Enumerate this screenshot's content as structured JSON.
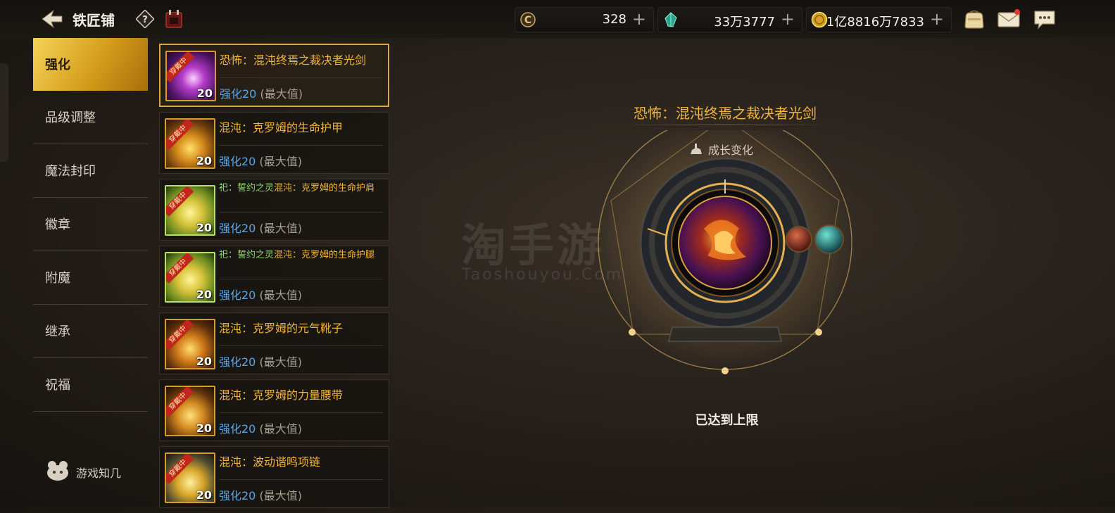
{
  "header": {
    "title": "铁匠铺",
    "currencies": [
      {
        "icon": "c-coin-icon",
        "value": "328"
      },
      {
        "icon": "crystal-icon",
        "value": "33万3777"
      },
      {
        "icon": "gold-coin-icon",
        "value": "1亿8816万7833"
      }
    ],
    "plus_symbol": "+"
  },
  "sidebar": {
    "items": [
      {
        "label": "强化",
        "active": true
      },
      {
        "label": "品级调整"
      },
      {
        "label": "魔法封印"
      },
      {
        "label": "徽章"
      },
      {
        "label": "附魔"
      },
      {
        "label": "继承"
      },
      {
        "label": "祝福"
      }
    ],
    "footer": "游戏知几"
  },
  "equipment": [
    {
      "name": "恐怖：混沌终焉之裁决者光剑",
      "level": "强化20",
      "max": "(最大值)",
      "thumb_level": "20",
      "badge": "穿戴中",
      "selected": true
    },
    {
      "name": "混沌：克罗姆的生命护甲",
      "level": "强化20",
      "max": "(最大值)",
      "thumb_level": "20",
      "badge": "穿戴中"
    },
    {
      "prefix": "祀：誓约之灵",
      "name": "混沌：克罗姆的生命护肩",
      "level": "强化20",
      "max": "(最大值)",
      "thumb_level": "20",
      "badge": "穿戴中"
    },
    {
      "prefix": "祀：誓约之灵",
      "name": "混沌：克罗姆的生命护腿",
      "level": "强化20",
      "max": "(最大值)",
      "thumb_level": "20",
      "badge": "穿戴中"
    },
    {
      "name": "混沌：克罗姆的元气靴子",
      "level": "强化20",
      "max": "(最大值)",
      "thumb_level": "20",
      "badge": "穿戴中"
    },
    {
      "name": "混沌：克罗姆的力量腰带",
      "level": "强化20",
      "max": "(最大值)",
      "thumb_level": "20",
      "badge": "穿戴中"
    },
    {
      "name": "混沌：波动谐鸣项链",
      "level": "强化20",
      "max": "(最大值)",
      "thumb_level": "20",
      "badge": "穿戴中"
    }
  ],
  "detail": {
    "name": "恐怖：混沌终焉之裁决者光剑",
    "growth": "成长变化",
    "status": "已达到上限"
  },
  "watermark": {
    "text": "淘手游",
    "sub": "Taoshouyou.Com"
  },
  "colors": {
    "accent": "#f0b43a",
    "active_tab": "#e9b62c",
    "level_blue": "#58a6e8"
  }
}
